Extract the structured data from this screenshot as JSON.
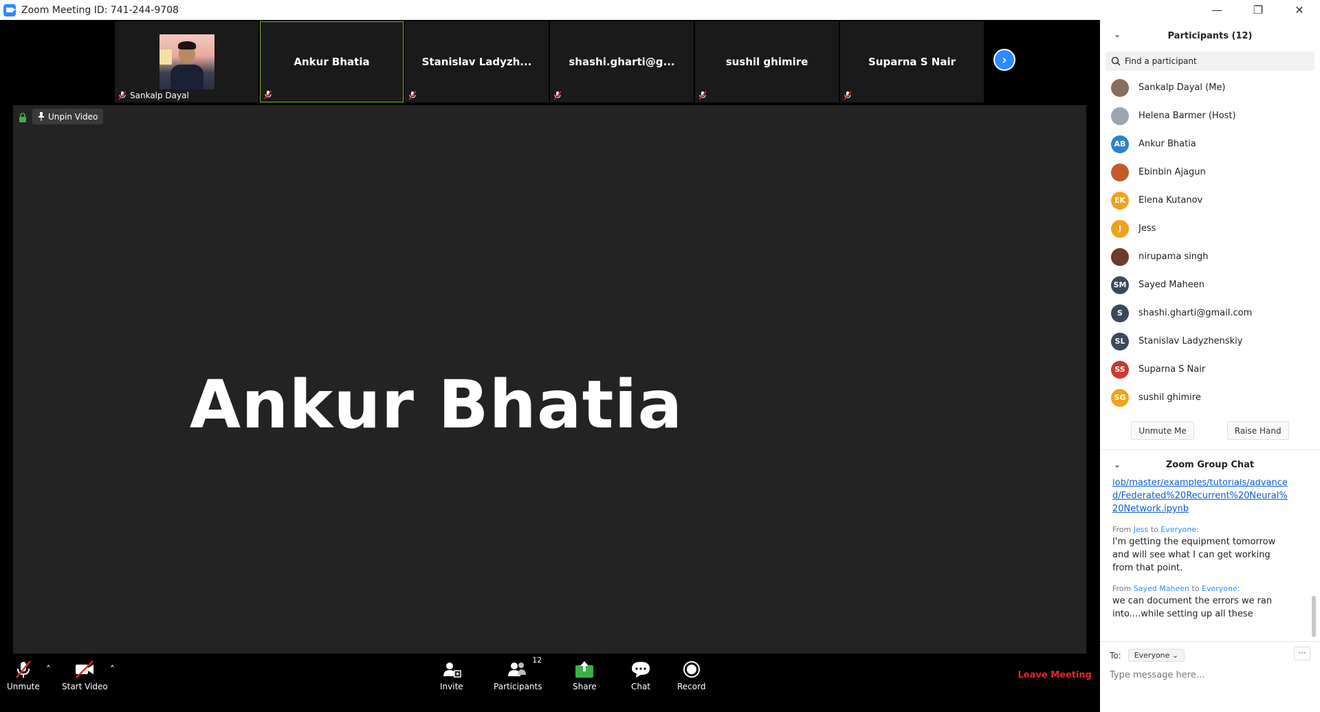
{
  "window": {
    "title": "Zoom Meeting ID: 741-244-9708"
  },
  "thumbnails": [
    {
      "name": "Sankalp Dayal",
      "has_video": true
    },
    {
      "name": "Ankur Bhatia",
      "active": true
    },
    {
      "name": "Stanislav  Ladyzh..."
    },
    {
      "name": "shashi.gharti@g..."
    },
    {
      "name": "sushil ghimire"
    },
    {
      "name": "Suparna S Nair"
    }
  ],
  "stage": {
    "speaker_name": "Ankur Bhatia",
    "unpin_label": "Unpin Video"
  },
  "toolbar": {
    "unmute": "Unmute",
    "start_video": "Start Video",
    "invite": "Invite",
    "participants": "Participants",
    "participants_count": "12",
    "share": "Share",
    "chat": "Chat",
    "record": "Record",
    "leave": "Leave Meeting"
  },
  "panel": {
    "title": "Participants (12)",
    "search_placeholder": "Find a participant",
    "participants": [
      {
        "name": "Sankalp Dayal (Me)",
        "initials": "",
        "color": "#8a6d5b",
        "photo": true
      },
      {
        "name": "Helena Barmer (Host)",
        "initials": "",
        "color": "#9aa5b1",
        "photo": true,
        "mic_on": true
      },
      {
        "name": "Ankur Bhatia",
        "initials": "AB",
        "color": "#2b83c6"
      },
      {
        "name": "Ebinbin Ajagun",
        "initials": "",
        "color": "#c25b2a",
        "photo": true
      },
      {
        "name": "Elena Kutanov",
        "initials": "EK",
        "color": "#f0a21b"
      },
      {
        "name": "Jess",
        "initials": "J",
        "color": "#f0a21b"
      },
      {
        "name": "nirupama singh",
        "initials": "",
        "color": "#6d3b2a",
        "photo": true
      },
      {
        "name": "Sayed Maheen",
        "initials": "SM",
        "color": "#3a4a5c"
      },
      {
        "name": "shashi.gharti@gmail.com",
        "initials": "S",
        "color": "#3a4a5c"
      },
      {
        "name": "Stanislav Ladyzhenskiy",
        "initials": "SL",
        "color": "#3a4a5c"
      },
      {
        "name": "Suparna S Nair",
        "initials": "SS",
        "color": "#d0382d"
      },
      {
        "name": "sushil ghimire",
        "initials": "SG",
        "color": "#f0a21b"
      }
    ],
    "unmute_me": "Unmute Me",
    "raise_hand": "Raise Hand"
  },
  "chat": {
    "title": "Zoom Group Chat",
    "link_text": "lob/master/examples/tutorials/advanced/Federated%20Recurrent%20Neural%20Network.ipynb",
    "messages": [
      {
        "from_prefix": "From",
        "sender": "Jess",
        "to_word": "to",
        "recipient": "Everyone:",
        "text": "I'm getting the equipment tomorrow and will see what I can get working from that point."
      },
      {
        "from_prefix": "From",
        "sender": "Sayed Maheen",
        "to_word": "to",
        "recipient": "Everyone:",
        "text": "we can document the errors we ran into....while setting up all these"
      }
    ],
    "to_label": "To:",
    "to_value": "Everyone",
    "more": "···",
    "input_placeholder": "Type message here..."
  }
}
